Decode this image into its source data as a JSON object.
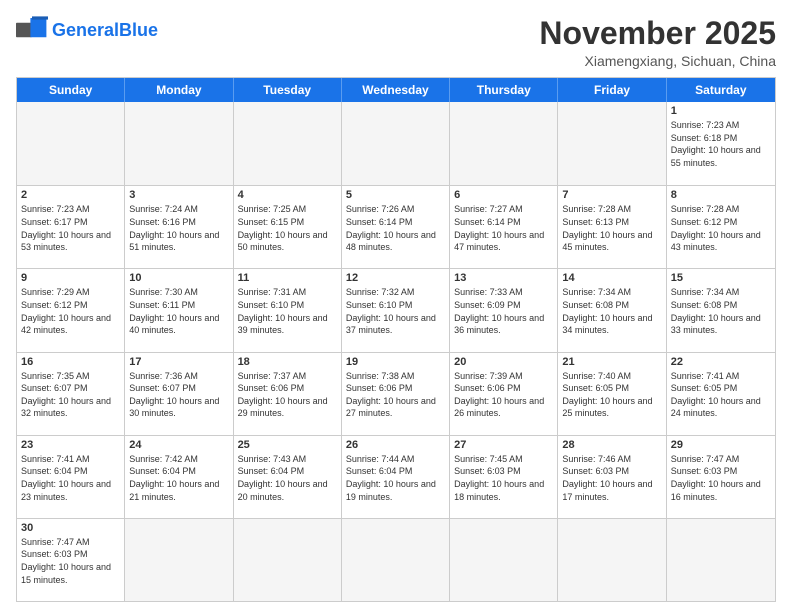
{
  "logo": {
    "text_general": "General",
    "text_blue": "Blue"
  },
  "header": {
    "month_title": "November 2025",
    "location": "Xiamengxiang, Sichuan, China"
  },
  "weekdays": [
    "Sunday",
    "Monday",
    "Tuesday",
    "Wednesday",
    "Thursday",
    "Friday",
    "Saturday"
  ],
  "weeks": [
    [
      {
        "day": "",
        "empty": true
      },
      {
        "day": "",
        "empty": true
      },
      {
        "day": "",
        "empty": true
      },
      {
        "day": "",
        "empty": true
      },
      {
        "day": "",
        "empty": true
      },
      {
        "day": "",
        "empty": true
      },
      {
        "day": "1",
        "sunrise": "7:23 AM",
        "sunset": "6:18 PM",
        "daylight": "10 hours and 55 minutes."
      }
    ],
    [
      {
        "day": "2",
        "sunrise": "7:23 AM",
        "sunset": "6:17 PM",
        "daylight": "10 hours and 53 minutes."
      },
      {
        "day": "3",
        "sunrise": "7:24 AM",
        "sunset": "6:16 PM",
        "daylight": "10 hours and 51 minutes."
      },
      {
        "day": "4",
        "sunrise": "7:25 AM",
        "sunset": "6:15 PM",
        "daylight": "10 hours and 50 minutes."
      },
      {
        "day": "5",
        "sunrise": "7:26 AM",
        "sunset": "6:14 PM",
        "daylight": "10 hours and 48 minutes."
      },
      {
        "day": "6",
        "sunrise": "7:27 AM",
        "sunset": "6:14 PM",
        "daylight": "10 hours and 47 minutes."
      },
      {
        "day": "7",
        "sunrise": "7:28 AM",
        "sunset": "6:13 PM",
        "daylight": "10 hours and 45 minutes."
      },
      {
        "day": "8",
        "sunrise": "7:28 AM",
        "sunset": "6:12 PM",
        "daylight": "10 hours and 43 minutes."
      }
    ],
    [
      {
        "day": "9",
        "sunrise": "7:29 AM",
        "sunset": "6:12 PM",
        "daylight": "10 hours and 42 minutes."
      },
      {
        "day": "10",
        "sunrise": "7:30 AM",
        "sunset": "6:11 PM",
        "daylight": "10 hours and 40 minutes."
      },
      {
        "day": "11",
        "sunrise": "7:31 AM",
        "sunset": "6:10 PM",
        "daylight": "10 hours and 39 minutes."
      },
      {
        "day": "12",
        "sunrise": "7:32 AM",
        "sunset": "6:10 PM",
        "daylight": "10 hours and 37 minutes."
      },
      {
        "day": "13",
        "sunrise": "7:33 AM",
        "sunset": "6:09 PM",
        "daylight": "10 hours and 36 minutes."
      },
      {
        "day": "14",
        "sunrise": "7:34 AM",
        "sunset": "6:08 PM",
        "daylight": "10 hours and 34 minutes."
      },
      {
        "day": "15",
        "sunrise": "7:34 AM",
        "sunset": "6:08 PM",
        "daylight": "10 hours and 33 minutes."
      }
    ],
    [
      {
        "day": "16",
        "sunrise": "7:35 AM",
        "sunset": "6:07 PM",
        "daylight": "10 hours and 32 minutes."
      },
      {
        "day": "17",
        "sunrise": "7:36 AM",
        "sunset": "6:07 PM",
        "daylight": "10 hours and 30 minutes."
      },
      {
        "day": "18",
        "sunrise": "7:37 AM",
        "sunset": "6:06 PM",
        "daylight": "10 hours and 29 minutes."
      },
      {
        "day": "19",
        "sunrise": "7:38 AM",
        "sunset": "6:06 PM",
        "daylight": "10 hours and 27 minutes."
      },
      {
        "day": "20",
        "sunrise": "7:39 AM",
        "sunset": "6:06 PM",
        "daylight": "10 hours and 26 minutes."
      },
      {
        "day": "21",
        "sunrise": "7:40 AM",
        "sunset": "6:05 PM",
        "daylight": "10 hours and 25 minutes."
      },
      {
        "day": "22",
        "sunrise": "7:41 AM",
        "sunset": "6:05 PM",
        "daylight": "10 hours and 24 minutes."
      }
    ],
    [
      {
        "day": "23",
        "sunrise": "7:41 AM",
        "sunset": "6:04 PM",
        "daylight": "10 hours and 23 minutes."
      },
      {
        "day": "24",
        "sunrise": "7:42 AM",
        "sunset": "6:04 PM",
        "daylight": "10 hours and 21 minutes."
      },
      {
        "day": "25",
        "sunrise": "7:43 AM",
        "sunset": "6:04 PM",
        "daylight": "10 hours and 20 minutes."
      },
      {
        "day": "26",
        "sunrise": "7:44 AM",
        "sunset": "6:04 PM",
        "daylight": "10 hours and 19 minutes."
      },
      {
        "day": "27",
        "sunrise": "7:45 AM",
        "sunset": "6:03 PM",
        "daylight": "10 hours and 18 minutes."
      },
      {
        "day": "28",
        "sunrise": "7:46 AM",
        "sunset": "6:03 PM",
        "daylight": "10 hours and 17 minutes."
      },
      {
        "day": "29",
        "sunrise": "7:47 AM",
        "sunset": "6:03 PM",
        "daylight": "10 hours and 16 minutes."
      }
    ],
    [
      {
        "day": "30",
        "sunrise": "7:47 AM",
        "sunset": "6:03 PM",
        "daylight": "10 hours and 15 minutes."
      },
      {
        "day": "",
        "empty": true
      },
      {
        "day": "",
        "empty": true
      },
      {
        "day": "",
        "empty": true
      },
      {
        "day": "",
        "empty": true
      },
      {
        "day": "",
        "empty": true
      },
      {
        "day": "",
        "empty": true
      }
    ]
  ]
}
